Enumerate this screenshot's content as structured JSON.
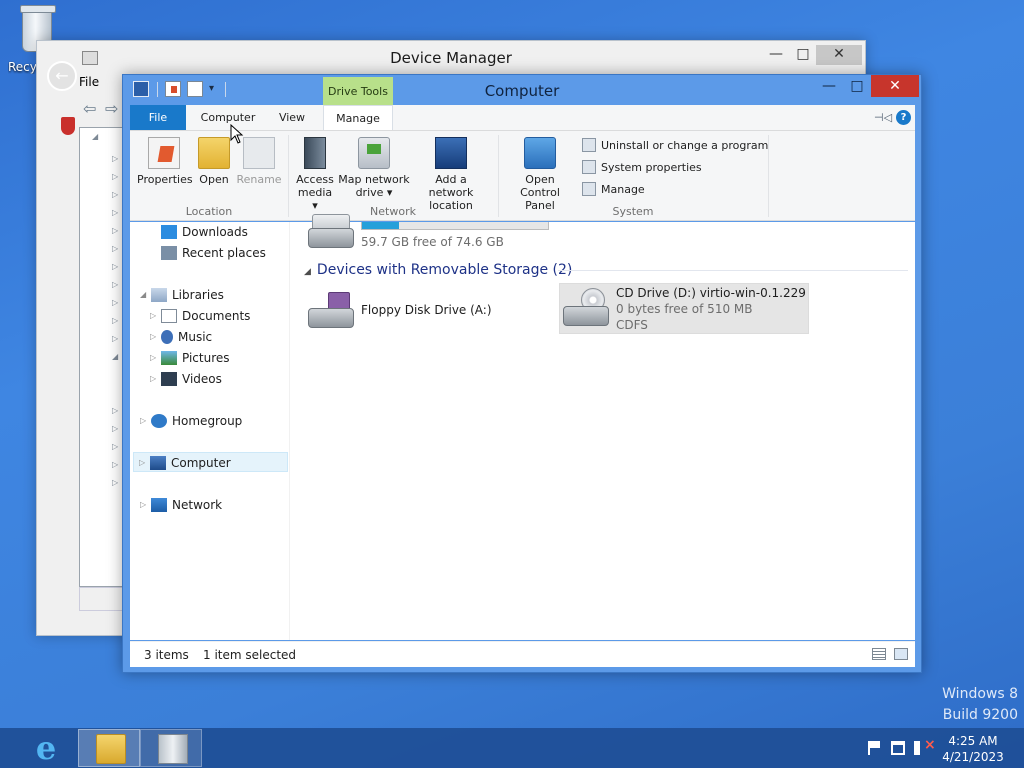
{
  "desktop": {
    "recycle_bin_label": "Recyc",
    "watermark_line1": "Windows 8",
    "watermark_line2": "Build 9200"
  },
  "device_manager": {
    "title": "Device Manager",
    "menu_file": "File",
    "caption_min": "—",
    "caption_max": "□",
    "caption_close": "✕"
  },
  "explorer": {
    "title": "Computer",
    "context_tab": "Drive Tools",
    "caption_min": "—",
    "caption_max": "□",
    "caption_close": "✕",
    "tabs": {
      "file": "File",
      "computer": "Computer",
      "view": "View",
      "manage": "Manage"
    },
    "ribbon": {
      "location": {
        "label": "Location",
        "properties": "Properties",
        "open": "Open",
        "rename": "Rename"
      },
      "network": {
        "label": "Network",
        "access_media_1": "Access",
        "access_media_2": "media ▾",
        "map_drive_1": "Map network",
        "map_drive_2": "drive ▾",
        "add_location_1": "Add a network",
        "add_location_2": "location"
      },
      "system": {
        "label": "System",
        "control_panel_1": "Open Control",
        "control_panel_2": "Panel",
        "uninstall": "Uninstall or change a program",
        "system_properties": "System properties",
        "manage": "Manage"
      }
    },
    "nav": {
      "downloads": "Downloads",
      "recent": "Recent places",
      "libraries": "Libraries",
      "documents": "Documents",
      "music": "Music",
      "pictures": "Pictures",
      "videos": "Videos",
      "homegroup": "Homegroup",
      "computer": "Computer",
      "network": "Network"
    },
    "content": {
      "c_drive_free": "59.7 GB free of 74.6 GB",
      "c_drive_used_fraction": 0.2,
      "removable_header": "Devices with Removable Storage (2)",
      "floppy_name": "Floppy Disk Drive (A:)",
      "cd_name": "CD Drive (D:) virtio-win-0.1.229",
      "cd_free": "0 bytes free of 510 MB",
      "cd_fs": "CDFS"
    },
    "status": {
      "items": "3 items",
      "selected": "1 item selected"
    }
  },
  "taskbar": {
    "ie_glyph": "e",
    "clock_time": "4:25 AM",
    "clock_date": "4/21/2023"
  },
  "colors": {
    "accent": "#1979ca",
    "context_tab": "#b8e08a",
    "close_button": "#c7352c",
    "desktop": "#3b7fd8"
  }
}
